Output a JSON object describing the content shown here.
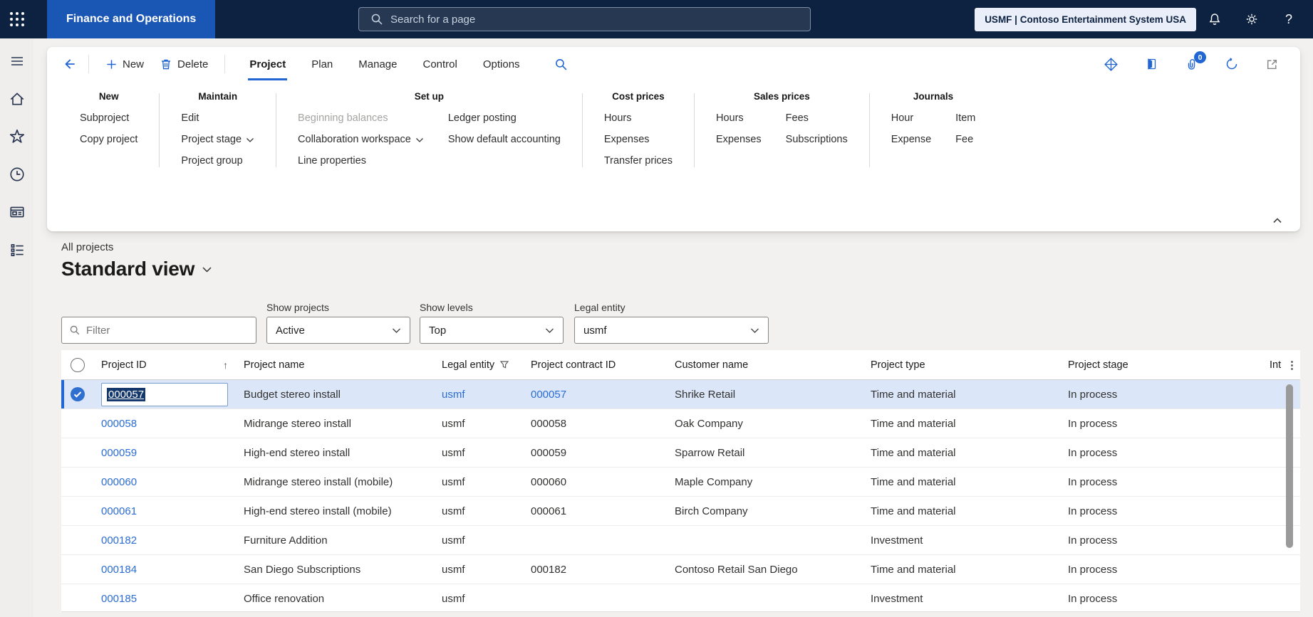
{
  "topbar": {
    "app_name": "Finance and Operations",
    "search_placeholder": "Search for a page",
    "company_badge": "USMF | Contoso Entertainment System USA",
    "icons": [
      "app-launcher",
      "search",
      "notifications",
      "settings",
      "help"
    ],
    "help_glyph": "?"
  },
  "sidebar": {
    "icons": [
      "menu",
      "home",
      "favorites",
      "recent",
      "workspaces",
      "modules"
    ]
  },
  "ribbon": {
    "actions": {
      "new": "New",
      "delete": "Delete"
    },
    "tabs": [
      {
        "label": "Project",
        "active": true
      },
      {
        "label": "Plan",
        "active": false
      },
      {
        "label": "Manage",
        "active": false
      },
      {
        "label": "Control",
        "active": false
      },
      {
        "label": "Options",
        "active": false
      }
    ],
    "right_icons": [
      "dynamics-app",
      "office-book",
      "attachments",
      "refresh",
      "open-in-new"
    ],
    "attachments_count": "0",
    "groups": [
      {
        "title": "New",
        "columns": [
          [
            {
              "label": "Subproject"
            },
            {
              "label": "Copy project"
            }
          ]
        ]
      },
      {
        "title": "Maintain",
        "columns": [
          [
            {
              "label": "Edit"
            },
            {
              "label": "Project stage",
              "chevron": true
            },
            {
              "label": "Project group"
            }
          ]
        ]
      },
      {
        "title": "Set up",
        "columns": [
          [
            {
              "label": "Beginning balances",
              "disabled": true
            },
            {
              "label": "Collaboration workspace",
              "chevron": true
            },
            {
              "label": "Line properties"
            }
          ],
          [
            {
              "label": "Ledger posting"
            },
            {
              "label": "Show default accounting"
            }
          ]
        ]
      },
      {
        "title": "Cost prices",
        "columns": [
          [
            {
              "label": "Hours"
            },
            {
              "label": "Expenses"
            },
            {
              "label": "Transfer prices"
            }
          ]
        ]
      },
      {
        "title": "Sales prices",
        "columns": [
          [
            {
              "label": "Hours"
            },
            {
              "label": "Expenses"
            }
          ],
          [
            {
              "label": "Fees"
            },
            {
              "label": "Subscriptions"
            }
          ]
        ]
      },
      {
        "title": "Journals",
        "columns": [
          [
            {
              "label": "Hour"
            },
            {
              "label": "Expense"
            }
          ],
          [
            {
              "label": "Item"
            },
            {
              "label": "Fee"
            }
          ]
        ]
      }
    ]
  },
  "page": {
    "caption": "All projects",
    "view_title": "Standard view",
    "filters": {
      "filter_placeholder": "Filter",
      "show_projects_label": "Show projects",
      "show_projects_value": "Active",
      "show_levels_label": "Show levels",
      "show_levels_value": "Top",
      "legal_entity_label": "Legal entity",
      "legal_entity_value": "usmf"
    },
    "grid": {
      "headers": {
        "project_id": "Project ID",
        "project_name": "Project name",
        "legal_entity": "Legal entity",
        "contract_id": "Project contract ID",
        "customer": "Customer name",
        "type": "Project type",
        "stage": "Project stage",
        "int_truncated": "Int",
        "kebab_glyph": "⋮",
        "sort_glyph": "↑"
      },
      "rows": [
        {
          "project_id": "000057",
          "project_name": "Budget stereo install",
          "legal_entity": "usmf",
          "contract_id": "000057",
          "customer": "Shrike Retail",
          "type": "Time and material",
          "stage": "In process",
          "selected": true
        },
        {
          "project_id": "000058",
          "project_name": "Midrange stereo install",
          "legal_entity": "usmf",
          "contract_id": "000058",
          "customer": "Oak Company",
          "type": "Time and material",
          "stage": "In process"
        },
        {
          "project_id": "000059",
          "project_name": "High-end stereo install",
          "legal_entity": "usmf",
          "contract_id": "000059",
          "customer": "Sparrow Retail",
          "type": "Time and material",
          "stage": "In process"
        },
        {
          "project_id": "000060",
          "project_name": "Midrange stereo install (mobile)",
          "legal_entity": "usmf",
          "contract_id": "000060",
          "customer": "Maple Company",
          "type": "Time and material",
          "stage": "In process"
        },
        {
          "project_id": "000061",
          "project_name": "High-end stereo install (mobile)",
          "legal_entity": "usmf",
          "contract_id": "000061",
          "customer": "Birch Company",
          "type": "Time and material",
          "stage": "In process"
        },
        {
          "project_id": "000182",
          "project_name": "Furniture Addition",
          "legal_entity": "usmf",
          "contract_id": "",
          "customer": "",
          "type": "Investment",
          "stage": "In process"
        },
        {
          "project_id": "000184",
          "project_name": "San Diego Subscriptions",
          "legal_entity": "usmf",
          "contract_id": "000182",
          "customer": "Contoso Retail San Diego",
          "type": "Time and material",
          "stage": "In process"
        },
        {
          "project_id": "000185",
          "project_name": "Office renovation",
          "legal_entity": "usmf",
          "contract_id": "",
          "customer": "",
          "type": "Investment",
          "stage": "In process"
        }
      ]
    }
  },
  "colors": {
    "accent": "#2266D3",
    "topbar_bg": "#0D2240",
    "brand_bg": "#1A56B4",
    "link": "#2B6CD4",
    "selected_row_bg": "#DBE7F8"
  }
}
